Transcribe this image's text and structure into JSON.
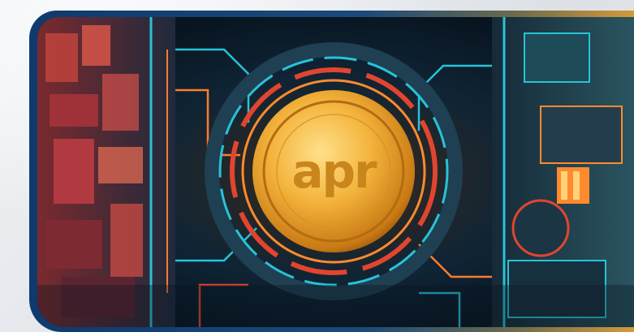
{
  "image": {
    "subject": "apr coin",
    "coin_label": "apr",
    "colors": {
      "frame_left": "#0f3a6e",
      "frame_right": "#d49a3a",
      "coin_gold": "#f0b53a",
      "neon_cyan": "#27c3d6",
      "neon_red": "#e2452f"
    }
  }
}
